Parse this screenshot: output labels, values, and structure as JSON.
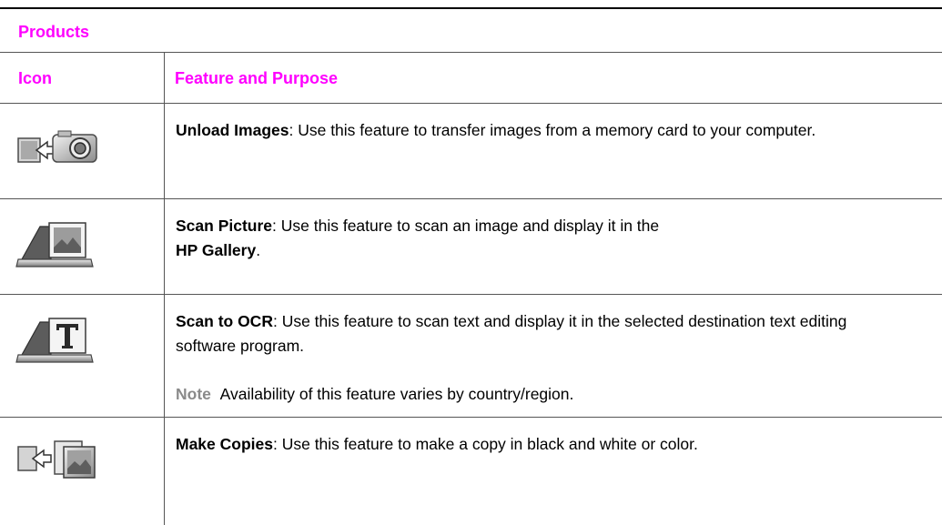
{
  "section": {
    "title": "Products"
  },
  "columns": {
    "icon": "Icon",
    "feature": "Feature and Purpose"
  },
  "rows": [
    {
      "icon": "unload-images-icon",
      "name": "Unload Images",
      "text": ": Use this feature to transfer images from a memory card to your computer."
    },
    {
      "icon": "scan-picture-icon",
      "name": "Scan Picture",
      "text": ": Use this feature to scan an image and display it in the",
      "extra_bold": "HP Gallery",
      "extra_tail": "."
    },
    {
      "icon": "scan-to-ocr-icon",
      "name": "Scan to OCR",
      "text": ": Use this feature to scan text and display it in the selected destination text editing software program.",
      "note_label": "Note",
      "note_text": "Availability of this feature varies by country/region."
    },
    {
      "icon": "make-copies-icon",
      "name": "Make Copies",
      "text": ": Use this feature to make a copy in black and white or color."
    }
  ],
  "colors": {
    "heading": "#ff00ff",
    "note": "#8a8a8a",
    "rule": "#555555"
  }
}
